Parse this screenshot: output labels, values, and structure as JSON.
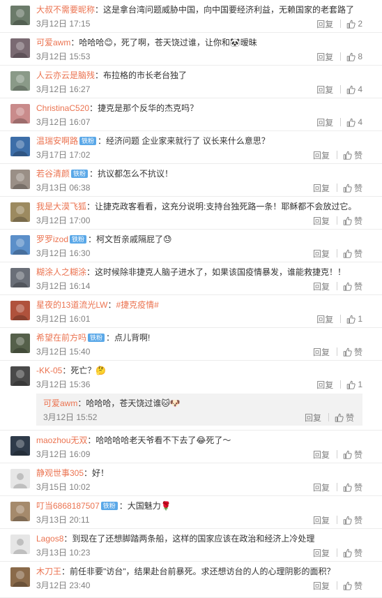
{
  "comments": [
    {
      "user": "大叔不需要昵称",
      "badge": "",
      "text": "这是拿台湾问题威胁中国，向中国要经济利益，无赖国家的老套路了",
      "time": "3月12日 17:15",
      "reply": "回复",
      "likes": "2",
      "avatar_color": "#6b7b6a",
      "avatar_icon": "avatar-photo"
    },
    {
      "user": "可爱awm",
      "badge": "",
      "text": "哈哈哈😊，死了啊，苍天饶过谁，让你和🐼暧昧",
      "time": "3月12日 15:53",
      "reply": "回复",
      "likes": "8",
      "avatar_color": "#7a6a72",
      "avatar_icon": "avatar-photo"
    },
    {
      "user": "人云亦云是脑残",
      "badge": "",
      "text": "布拉格的市长老台独了",
      "time": "3月12日 16:27",
      "reply": "回复",
      "likes": "4",
      "avatar_color": "#8a9a88",
      "avatar_icon": "avatar-photo"
    },
    {
      "user": "ChristinaC520",
      "badge": "",
      "text": "捷克是那个反华的杰克吗？",
      "time": "3月12日 16:07",
      "reply": "回复",
      "likes": "4",
      "avatar_color": "#c98b8b",
      "avatar_icon": "avatar-photo"
    },
    {
      "user": "温瑞安啊路",
      "badge": "铁粉",
      "text": "经济问题   企业家来就行了   议长来什么意思？",
      "time": "3月17日 17:02",
      "reply": "回复",
      "likes": "赞",
      "avatar_color": "#3d6ea8",
      "avatar_icon": "avatar-photo"
    },
    {
      "user": "若谷清颜",
      "badge": "铁粉",
      "text": "抗议都怎么不抗议！",
      "time": "3月13日 06:38",
      "reply": "回复",
      "likes": "赞",
      "avatar_color": "#9a8f86",
      "avatar_icon": "avatar-photo"
    },
    {
      "user": "我是大漠飞狐",
      "badge": "",
      "text": "让捷克政客看看，这充分说明:支持台独死路一条！耶稣都不会放过它。",
      "time": "3月12日 17:00",
      "reply": "回复",
      "likes": "赞",
      "avatar_color": "#9c8a60",
      "avatar_icon": "avatar-photo"
    },
    {
      "user": "罗罗izod",
      "badge": "铁粉",
      "text": "柯文哲亲戚隔屁了😓",
      "time": "3月12日 16:30",
      "reply": "回复",
      "likes": "赞",
      "avatar_color": "#5b8fc9",
      "avatar_icon": "avatar-photo"
    },
    {
      "user": "糊涂人之糊涂",
      "badge": "",
      "text": "这时候除非捷克人脑子进水了，如果该国疫情暴发，谁能救捷克！！",
      "time": "3月12日 16:14",
      "reply": "回复",
      "likes": "赞",
      "avatar_color": "#6a6f78",
      "avatar_icon": "avatar-photo"
    },
    {
      "user": "星夜的13道流光LW",
      "badge": "",
      "tag": "#捷克疫情#",
      "text": "",
      "time": "3月12日 16:01",
      "reply": "回复",
      "likes": "1",
      "avatar_color": "#b0523c",
      "avatar_icon": "avatar-photo"
    },
    {
      "user": "希望在前方吗",
      "badge": "铁粉",
      "text": "点儿背啊!",
      "time": "3月12日 15:40",
      "reply": "回复",
      "likes": "赞",
      "avatar_color": "#55604a",
      "avatar_icon": "avatar-photo"
    },
    {
      "user": "-KK-05",
      "badge": "",
      "text": "死亡？🤔",
      "time": "3月12日 15:36",
      "reply": "回复",
      "likes": "1",
      "avatar_color": "#4a4a4a",
      "avatar_icon": "avatar-photo"
    },
    {
      "user": "maozhou无双",
      "badge": "",
      "text": "哈哈哈哈老天爷看不下去了😂死了～",
      "time": "3月12日 16:09",
      "reply": "回复",
      "likes": "赞",
      "avatar_color": "#2f3b4a",
      "avatar_icon": "avatar-photo"
    },
    {
      "user": "静观世事305",
      "badge": "",
      "text": "好！",
      "time": "3月15日 10:02",
      "reply": "回复",
      "likes": "赞",
      "avatar_color": "#dcdcdc",
      "avatar_icon": "default-avatar"
    },
    {
      "user": "叮当6868187507",
      "badge": "铁粉",
      "text": "大国魅力🌹",
      "time": "3月13日 20:11",
      "reply": "回复",
      "likes": "赞",
      "avatar_color": "#a58a6c",
      "avatar_icon": "avatar-photo"
    },
    {
      "user": "Lagos8",
      "badge": "",
      "text": "到现在了还想脚踏两条船，这样的国家应该在政治和经济上冷处理",
      "time": "3月13日 10:23",
      "reply": "回复",
      "likes": "赞",
      "avatar_color": "#dcdcdc",
      "avatar_icon": "default-avatar"
    },
    {
      "user": "木刀王",
      "badge": "",
      "text": "前任非要\"访台\"，结果赴台前暴死。求还想访台的人的心理阴影的面积？",
      "time": "3月12日 23:40",
      "reply": "回复",
      "likes": "赞",
      "avatar_color": "#8a6a4a",
      "avatar_icon": "avatar-photo"
    }
  ],
  "subreply": {
    "user": "可爱awm",
    "text": "哈哈哈，苍天饶过谁🐱🐶",
    "time": "3月12日 15:52",
    "reply": "回复",
    "likes": "赞"
  },
  "colors": {
    "nickname": "#eb7350",
    "badge": "#5aa8e8",
    "meta": "#808080",
    "text": "#333333",
    "subreply_bg": "#f2f2f2"
  }
}
